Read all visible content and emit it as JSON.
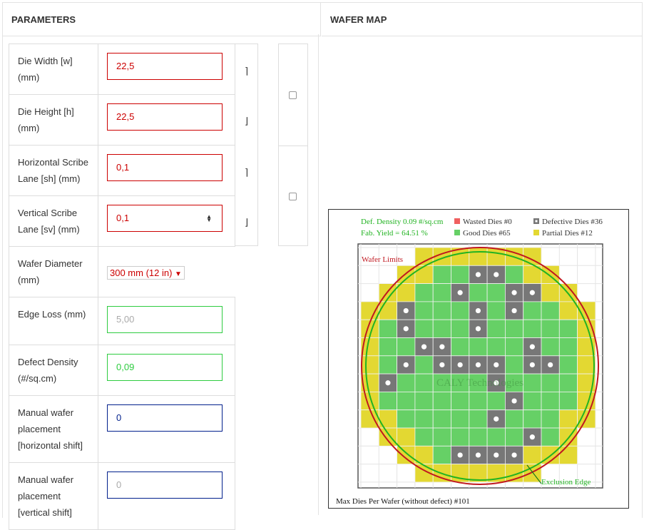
{
  "headers": {
    "parameters": "PARAMETERS",
    "wafer_map": "WAFER MAP"
  },
  "params": {
    "die_width": {
      "label": "Die Width [w] (mm)",
      "value": "22,5"
    },
    "die_height": {
      "label": "Die Height [h] (mm)",
      "value": "22,5"
    },
    "h_scribe": {
      "label": "Horizontal Scribe Lane [sh] (mm)",
      "value": "0,1"
    },
    "v_scribe": {
      "label": "Vertical Scribe Lane [sv] (mm)",
      "value": "0,1"
    },
    "wafer_diameter": {
      "label": "Wafer Diameter (mm)",
      "value": "300 mm (12 in)"
    },
    "edge_loss": {
      "label": "Edge Loss (mm)",
      "placeholder": "5,00"
    },
    "defect_density": {
      "label": "Defect Density (#/sq.cm)",
      "value": "0,09"
    },
    "manual_h": {
      "label": "Manual wafer placement [horizontal shift]",
      "value": "0"
    },
    "manual_v": {
      "label": "Manual wafer placement [vertical shift]",
      "placeholder": "0"
    }
  },
  "wafer_map": {
    "legend": {
      "def_density": "Def. Density 0.09 #/sq.cm",
      "fab_yield": "Fab. Yield = 64.51 %",
      "wasted": "Wasted Dies  #0",
      "good": "Good Dies #65",
      "defective": "Defective Dies  #36",
      "partial": "Partial Dies #12"
    },
    "wafer_limits": "Wafer Limits",
    "exclusion_edge": "Exclusion Edge",
    "watermark": "CALY Technologies",
    "footer": "Max Dies Per Wafer (without defect) #101",
    "colors": {
      "good": "#66d066",
      "defective": "#777777",
      "partial": "#e3d832",
      "wasted": "#f06060",
      "wafer": "#c01820",
      "exclusion": "#22b322"
    }
  }
}
